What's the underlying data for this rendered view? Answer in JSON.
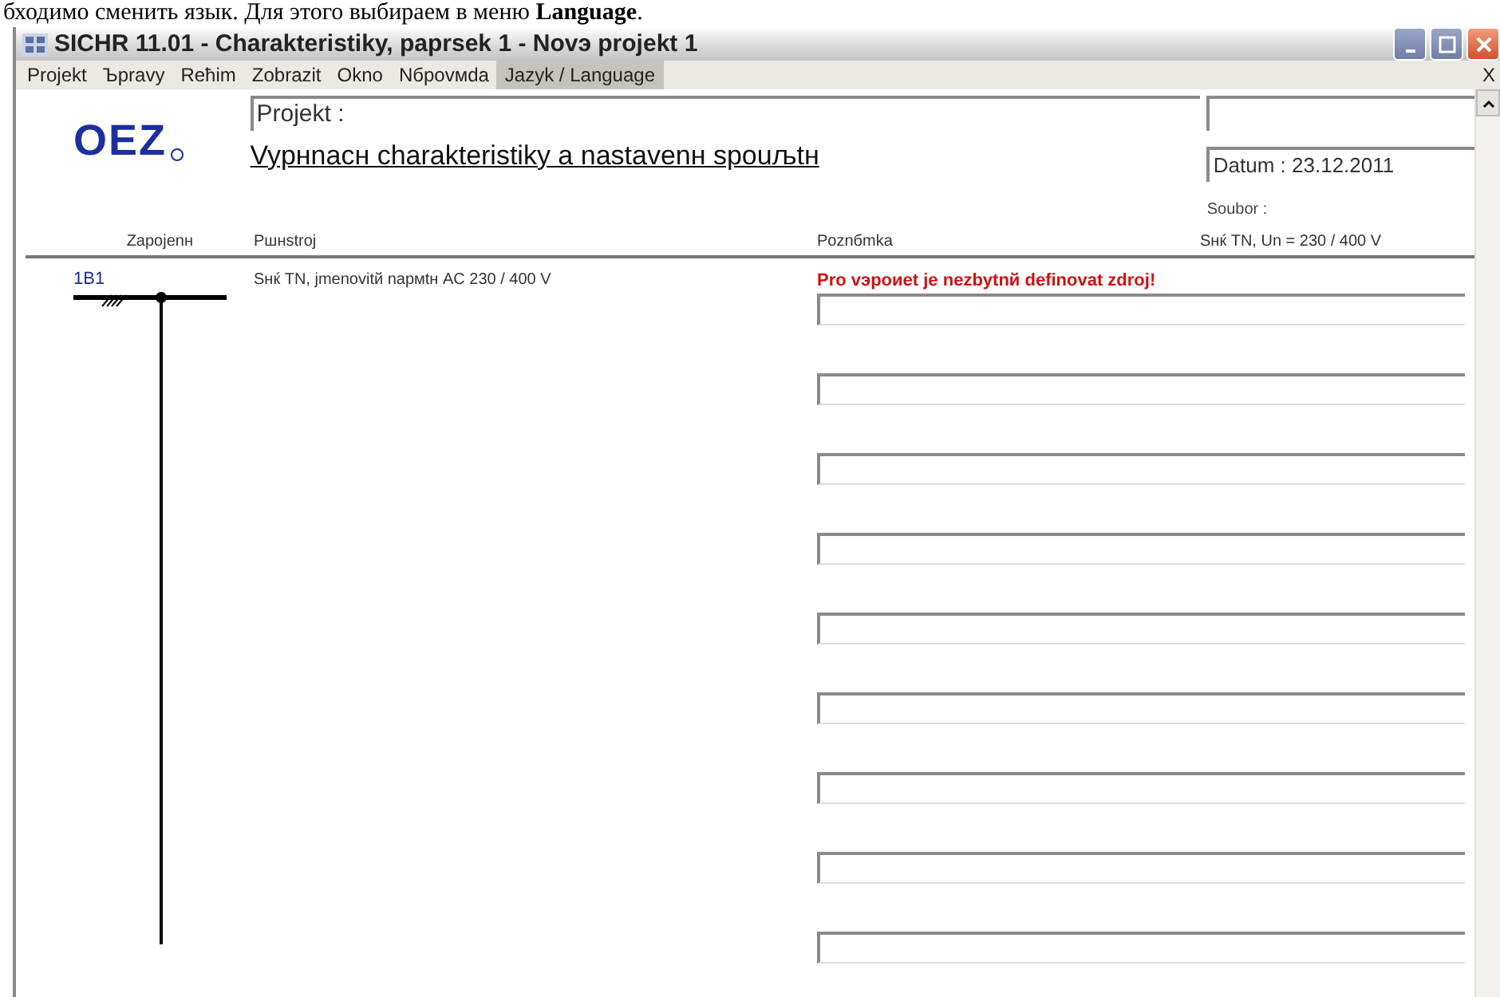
{
  "caption": "бходимо сменить язык. Для этого выбираем в меню **Language**.",
  "window": {
    "title": "SICHR 11.01 - Charakteristiky, paprsek 1 - Novэ projekt 1"
  },
  "menu": [
    {
      "label": "Projekt",
      "selected": false
    },
    {
      "label": "Ъpravy",
      "selected": false
    },
    {
      "label": "Reћim",
      "selected": false
    },
    {
      "label": "Zobrazit",
      "selected": false
    },
    {
      "label": "Okno",
      "selected": false
    },
    {
      "label": "Nбpovмda",
      "selected": false
    },
    {
      "label": "Jazyk / Language",
      "selected": true
    }
  ],
  "menu_close": "X",
  "logo": "OEZ",
  "project": {
    "label": "Projekt :",
    "title": "Vypнnacн charakteristiky a nastavenн spouљtн",
    "date": "Datum : 23.12.2011",
    "file_label": "Soubor :",
    "file": "Sнќ TN, Un = 230 / 400 V"
  },
  "columns": [
    "Zapojenн",
    "Pшнstroj",
    "Poznбmka"
  ],
  "rows": [
    {
      "designation": "1B1",
      "device": "Sнќ TN, jmenovitй napмtн AC 230 / 400 V",
      "note": "Pro vэpoиet je nezbytnй definovat zdroj!"
    }
  ]
}
